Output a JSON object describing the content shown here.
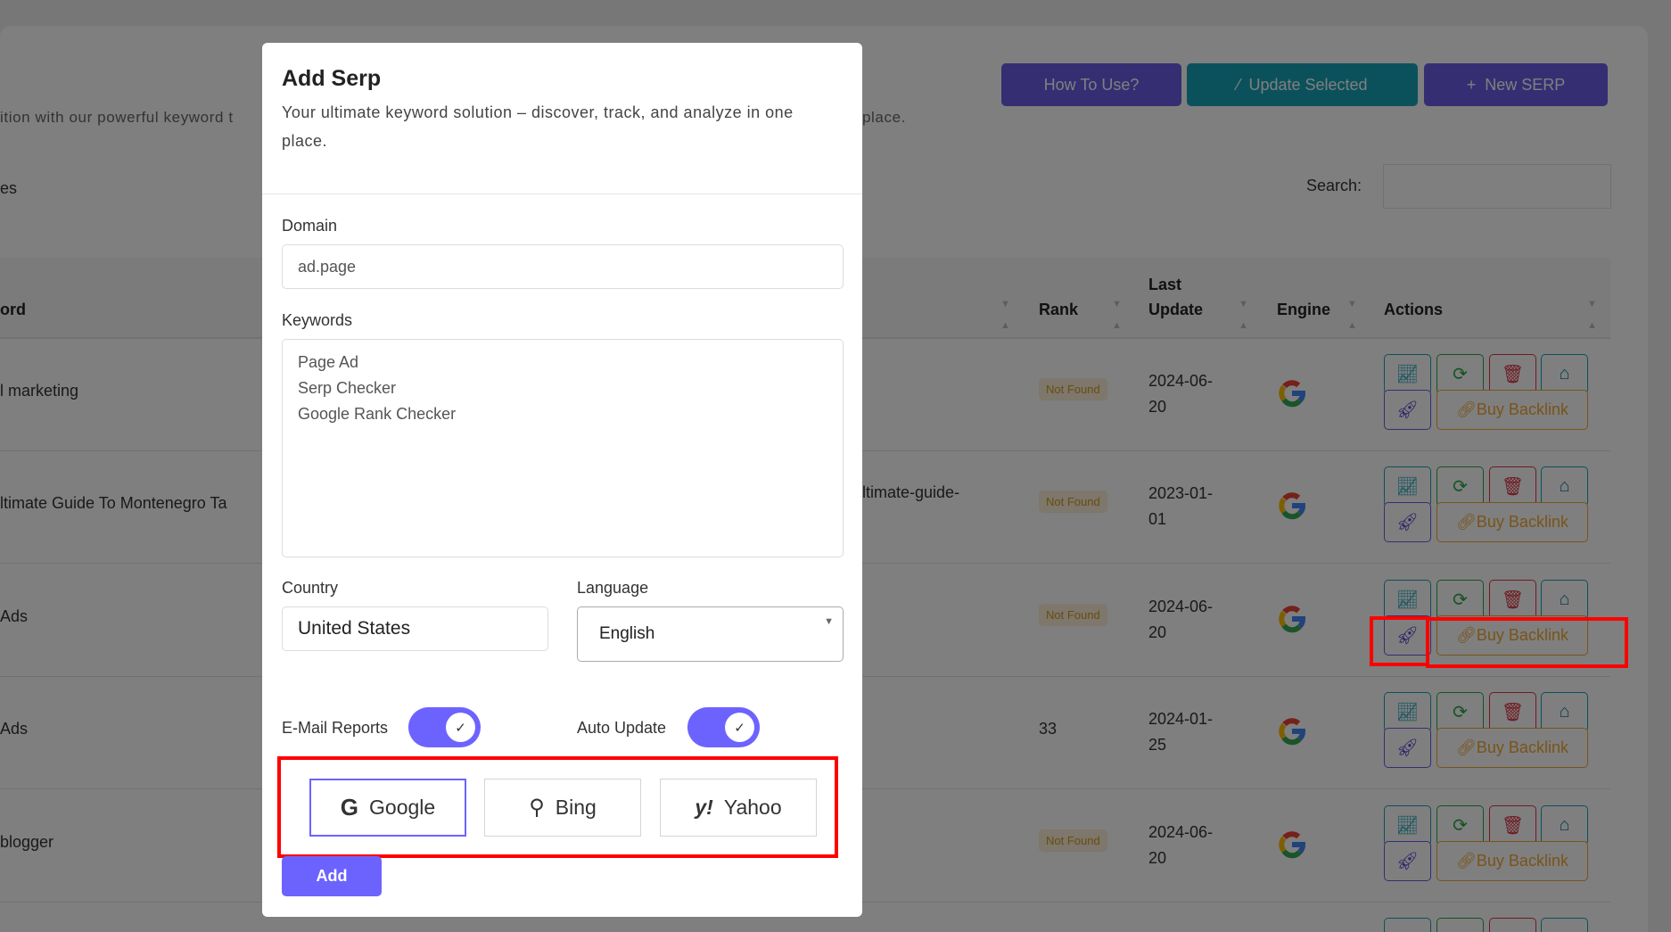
{
  "page": {
    "subtitle": "ition with our powerful keyword t",
    "subtitle_end": "place.",
    "entries_fragment": "es",
    "search_label": "Search:",
    "search_value": "",
    "buttons": {
      "how_to_use": "How To Use?",
      "update_selected": "Update Selected",
      "new_serp": "New SERP"
    },
    "colors": {
      "primary": "#6c5ce7",
      "teal": "#17a2b8",
      "warning": "#f0a935",
      "danger": "#dc3545",
      "success": "#28a745"
    }
  },
  "table": {
    "headers": {
      "keyword": "ord",
      "rank": "Rank",
      "last_update_1": "Last",
      "last_update_2": "Update",
      "engine": "Engine",
      "actions": "Actions"
    },
    "rows": [
      {
        "keyword": "l marketing",
        "url": "",
        "rank": "Not Found",
        "rank_found": false,
        "date1": "2024-06-",
        "date2": "20",
        "engine": "google"
      },
      {
        "keyword": "ltimate Guide To Montenegro Ta",
        "url": "ltimate-guide-",
        "rank": "Not Found",
        "rank_found": false,
        "date1": "2023-01-",
        "date2": "01",
        "engine": "google"
      },
      {
        "keyword": "Ads",
        "url": "",
        "rank": "Not Found",
        "rank_found": false,
        "date1": "2024-06-",
        "date2": "20",
        "engine": "google"
      },
      {
        "keyword": "Ads",
        "url": "",
        "rank": "33",
        "rank_found": true,
        "date1": "2024-01-",
        "date2": "25",
        "engine": "google"
      },
      {
        "keyword": "blogger",
        "url": "",
        "rank": "Not Found",
        "rank_found": false,
        "date1": "2024-06-",
        "date2": "20",
        "engine": "google"
      }
    ],
    "buy_backlink_label": "Buy Backlink"
  },
  "modal": {
    "title": "Add Serp",
    "description": "Your ultimate keyword solution – discover, track, and analyze in one place.",
    "domain_label": "Domain",
    "domain_value": "ad.page",
    "keywords_label": "Keywords",
    "keywords_value": "Page Ad\nSerp Checker\nGoogle Rank Checker",
    "country_label": "Country",
    "country_value": "United States",
    "language_label": "Language",
    "language_value": "English",
    "email_reports_label": "E-Mail Reports",
    "email_reports_on": true,
    "auto_update_label": "Auto Update",
    "auto_update_on": true,
    "engines": [
      {
        "label": "Google",
        "selected": true
      },
      {
        "label": "Bing",
        "selected": false
      },
      {
        "label": "Yahoo",
        "selected": false
      }
    ],
    "add_label": "Add"
  }
}
